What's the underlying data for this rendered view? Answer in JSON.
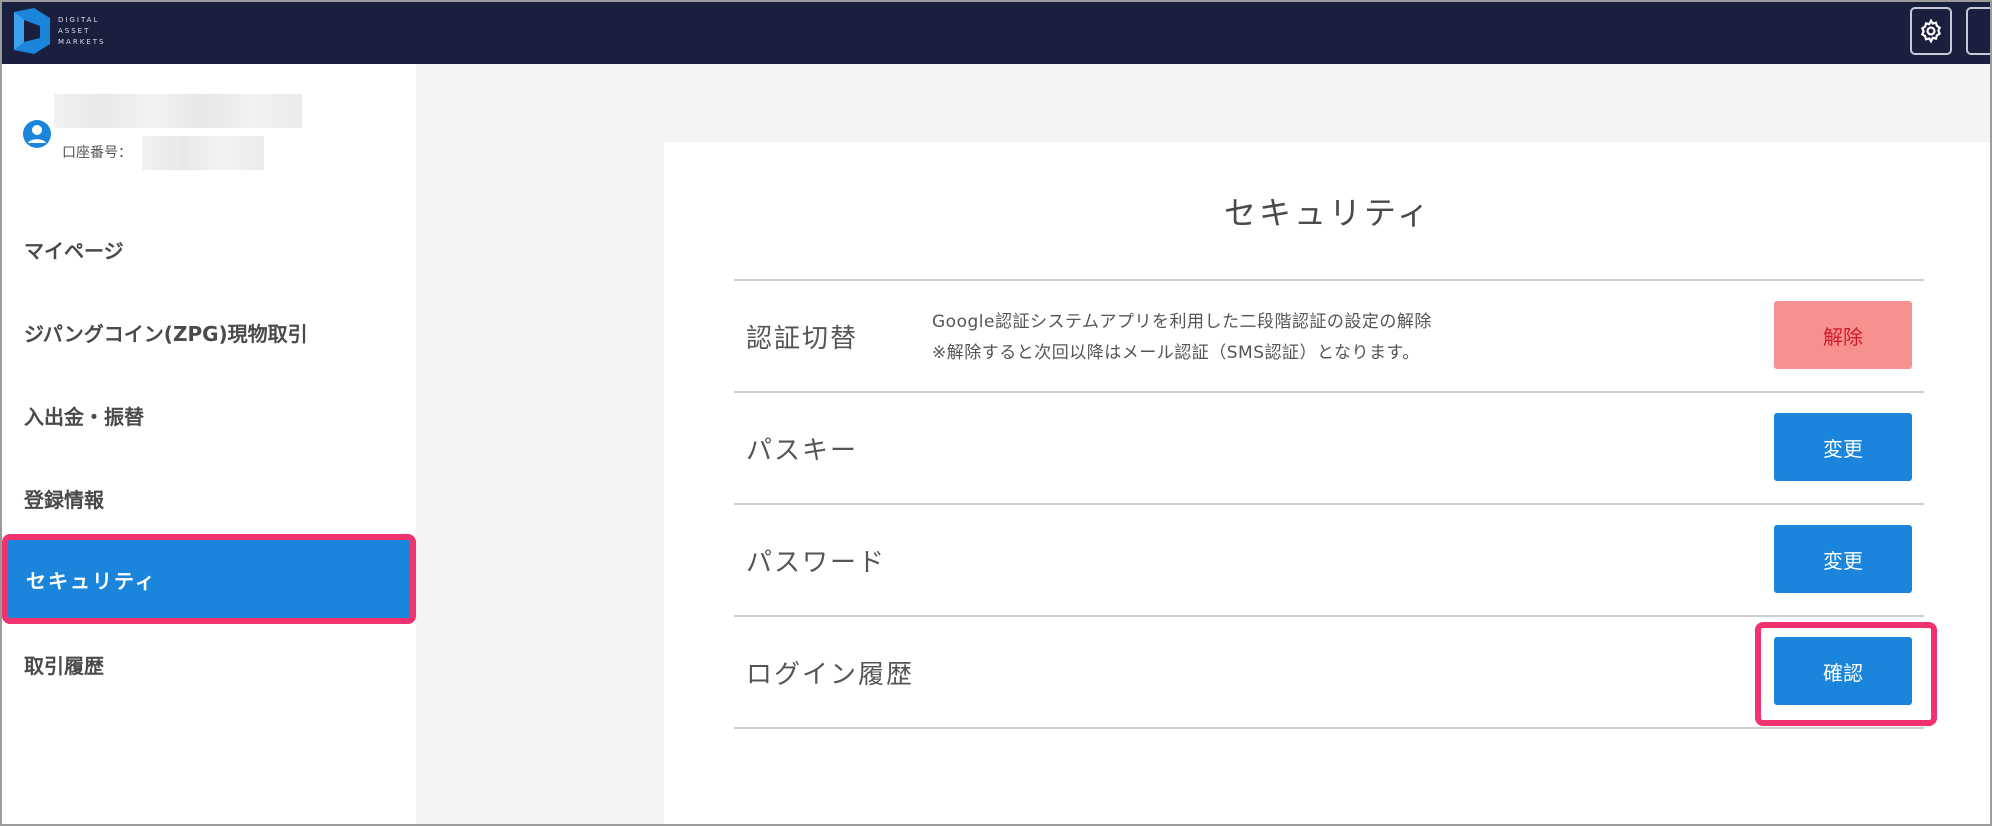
{
  "header": {
    "logo_lines": [
      "DIGITAL",
      "ASSET",
      "MARKETS"
    ],
    "icons": {
      "settings": "gear-icon",
      "logo": "digital-asset-markets-logo"
    }
  },
  "sidebar": {
    "account_label": "口座番号：",
    "items": [
      {
        "label": "マイページ",
        "active": false
      },
      {
        "label": "ジパングコイン(ZPG)現物取引",
        "active": false
      },
      {
        "label": "入出金・振替",
        "active": false
      },
      {
        "label": "登録情報",
        "active": false
      },
      {
        "label": "セキュリティ",
        "active": true
      },
      {
        "label": "取引履歴",
        "active": false
      }
    ]
  },
  "main": {
    "title": "セキュリティ",
    "rows": [
      {
        "label": "認証切替",
        "desc_line1": "Google認証システムアプリを利用した二段階認証の設定の解除",
        "desc_line2": "※解除すると次回以降はメール認証（SMS認証）となります。",
        "button": "解除"
      },
      {
        "label": "パスキー",
        "button": "変更"
      },
      {
        "label": "パスワード",
        "button": "変更"
      },
      {
        "label": "ログイン履歴",
        "button": "確認"
      }
    ]
  },
  "colors": {
    "topbar": "#1a1f3d",
    "accent": "#1a85db",
    "danger_bg": "#f6918f",
    "danger_text": "#d11a2b",
    "highlight": "#f0336e"
  }
}
